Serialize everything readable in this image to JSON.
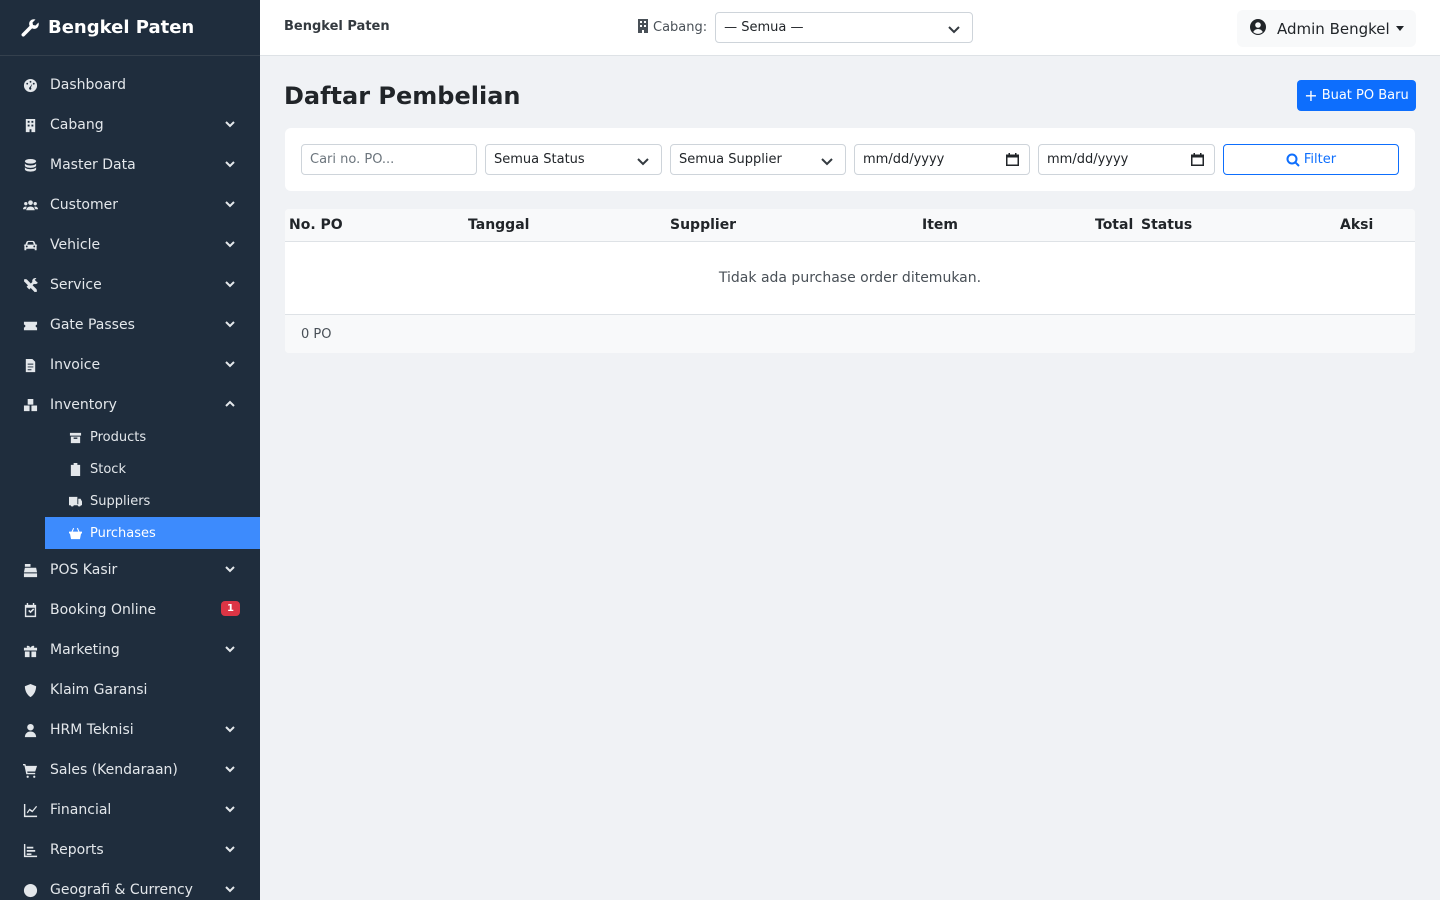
{
  "sidebar": {
    "brand": "Bengkel Paten",
    "items": [
      {
        "label": "Dashboard",
        "icon": "dashboard-icon"
      },
      {
        "label": "Cabang",
        "icon": "building-icon"
      },
      {
        "label": "Master Data",
        "icon": "database-icon"
      },
      {
        "label": "Customer",
        "icon": "users-icon"
      },
      {
        "label": "Vehicle",
        "icon": "car-icon"
      },
      {
        "label": "Service",
        "icon": "tools-icon"
      },
      {
        "label": "Gate Passes",
        "icon": "ticket-icon"
      },
      {
        "label": "Invoice",
        "icon": "invoice-icon"
      },
      {
        "label": "Inventory",
        "icon": "boxes-icon"
      },
      {
        "label": "POS Kasir",
        "icon": "cash-register-icon"
      },
      {
        "label": "Booking Online",
        "icon": "calendar-check-icon",
        "badge": "1"
      },
      {
        "label": "Marketing",
        "icon": "gift-icon"
      },
      {
        "label": "Klaim Garansi",
        "icon": "shield-icon"
      },
      {
        "label": "HRM Teknisi",
        "icon": "user-tie-icon"
      },
      {
        "label": "Sales (Kendaraan)",
        "icon": "cart-icon"
      },
      {
        "label": "Financial",
        "icon": "chart-line-icon"
      },
      {
        "label": "Reports",
        "icon": "chart-bar-icon"
      },
      {
        "label": "Geografi & Currency",
        "icon": "globe-icon"
      }
    ],
    "inventory_sub": [
      {
        "label": "Products",
        "icon": "box-icon"
      },
      {
        "label": "Stock",
        "icon": "clipboard-icon"
      },
      {
        "label": "Suppliers",
        "icon": "truck-icon"
      },
      {
        "label": "Purchases",
        "icon": "basket-icon"
      }
    ]
  },
  "topbar": {
    "title": "Bengkel Paten",
    "branch_label": "Cabang:",
    "branch_value": "— Semua —",
    "user": "Admin Bengkel"
  },
  "page": {
    "title": "Daftar Pembelian",
    "new_button": "Buat PO Baru"
  },
  "filters": {
    "search_placeholder": "Cari no. PO...",
    "status": "Semua Status",
    "supplier": "Semua Supplier",
    "date_from": "mm/dd/yyyy",
    "date_to": "mm/dd/yyyy",
    "button": "Filter"
  },
  "table": {
    "columns": [
      "No. PO",
      "Tanggal",
      "Supplier",
      "Item",
      "Total",
      "Status",
      "Aksi"
    ],
    "empty": "Tidak ada purchase order ditemukan.",
    "footer": "0 PO"
  },
  "colors": {
    "sidebar_bg": "#1f2d3d",
    "active_item": "#3d8bfd",
    "primary": "#0d6efd",
    "badge": "#dc3545"
  }
}
